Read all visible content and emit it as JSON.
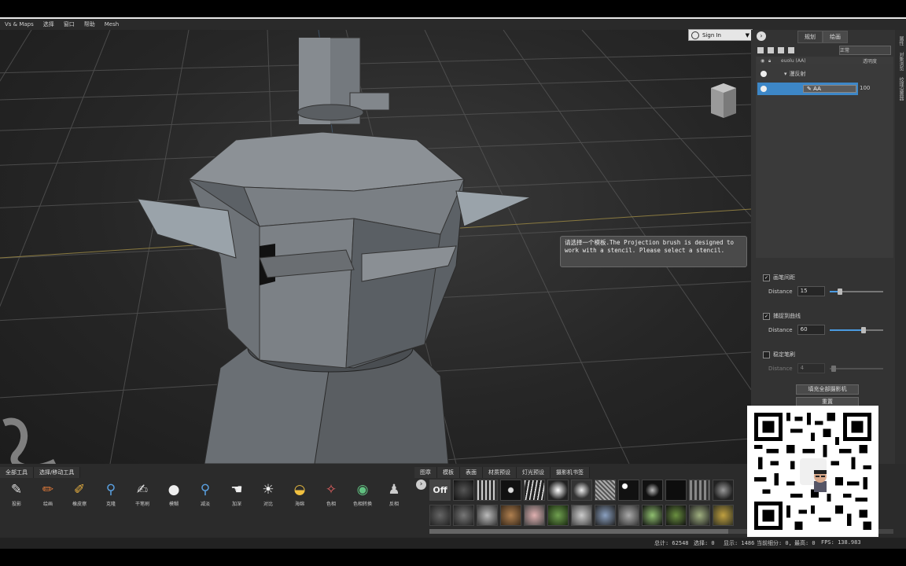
{
  "menu": [
    "Vs & Maps",
    "选择",
    "窗口",
    "帮助",
    "Mesh"
  ],
  "sign_in": {
    "label": "Sign In"
  },
  "right_tabs": [
    "规划",
    "绘画"
  ],
  "vertical_tabs": [
    "属性",
    "对象浏览",
    "纹理设置器"
  ],
  "layers": {
    "blend_mode": "正常",
    "header_name": "euolu (AA)",
    "header_opacity": "透明度",
    "group_name": "漫反射",
    "layer_name": "AA",
    "opacity_value": "100"
  },
  "properties": {
    "spacing_label": "画笔间距",
    "spacing_distance_label": "Distance",
    "spacing_distance_value": "15",
    "snap_label": "捕捉到曲线",
    "snap_distance_label": "Distance",
    "snap_distance_value": "60",
    "lazy_label": "稳定笔刷",
    "lazy_distance_label": "Distance",
    "lazy_distance_value": "4",
    "fill_button": "填充全部摄影机",
    "reset_button": "重置"
  },
  "tooltip": {
    "text": "请选择一个模板.The Projection brush is designed to work with a stencil. Please select a stencil."
  },
  "bottom_tabs_left": [
    "全部工具",
    "选择/移动工具"
  ],
  "bottom_tabs_right": [
    "图章",
    "模板",
    "表面",
    "材质预设",
    "灯光预设",
    "摄影机书签"
  ],
  "tools": [
    {
      "icon": "projection-brush-icon",
      "glyph": "✎",
      "label": "投影"
    },
    {
      "icon": "paint-icon",
      "glyph": "✏",
      "label": "绘画"
    },
    {
      "icon": "eraser-icon",
      "glyph": "✐",
      "label": "橡皮擦"
    },
    {
      "icon": "clone-icon",
      "glyph": "⚲",
      "label": "克隆"
    },
    {
      "icon": "dry-brush-icon",
      "glyph": "✍",
      "label": "干笔刷"
    },
    {
      "icon": "blur-icon",
      "glyph": "●",
      "label": "模糊"
    },
    {
      "icon": "dodge-icon",
      "glyph": "⚲",
      "label": "减淡"
    },
    {
      "icon": "burn-icon",
      "glyph": "☚",
      "label": "加深"
    },
    {
      "icon": "contrast-icon",
      "glyph": "☀",
      "label": "对比"
    },
    {
      "icon": "sponge-icon",
      "glyph": "◒",
      "label": "海绵"
    },
    {
      "icon": "hue-icon",
      "glyph": "✧",
      "label": "色相"
    },
    {
      "icon": "color-swap-icon",
      "glyph": "◉",
      "label": "色相转换"
    },
    {
      "icon": "reflection-icon",
      "glyph": "♟",
      "label": "反相"
    }
  ],
  "stencil_off": "Off",
  "status": {
    "total": "总计: 62548",
    "selected": "选择: 0",
    "display": "显示: 1486",
    "subdiv": "当前细分: 0,",
    "visible": "最高: 0",
    "fps": "FPS: 138.983"
  },
  "colors": {
    "accent": "#3d87c7",
    "panel": "#333333",
    "viewport": "#2a2a2a"
  }
}
